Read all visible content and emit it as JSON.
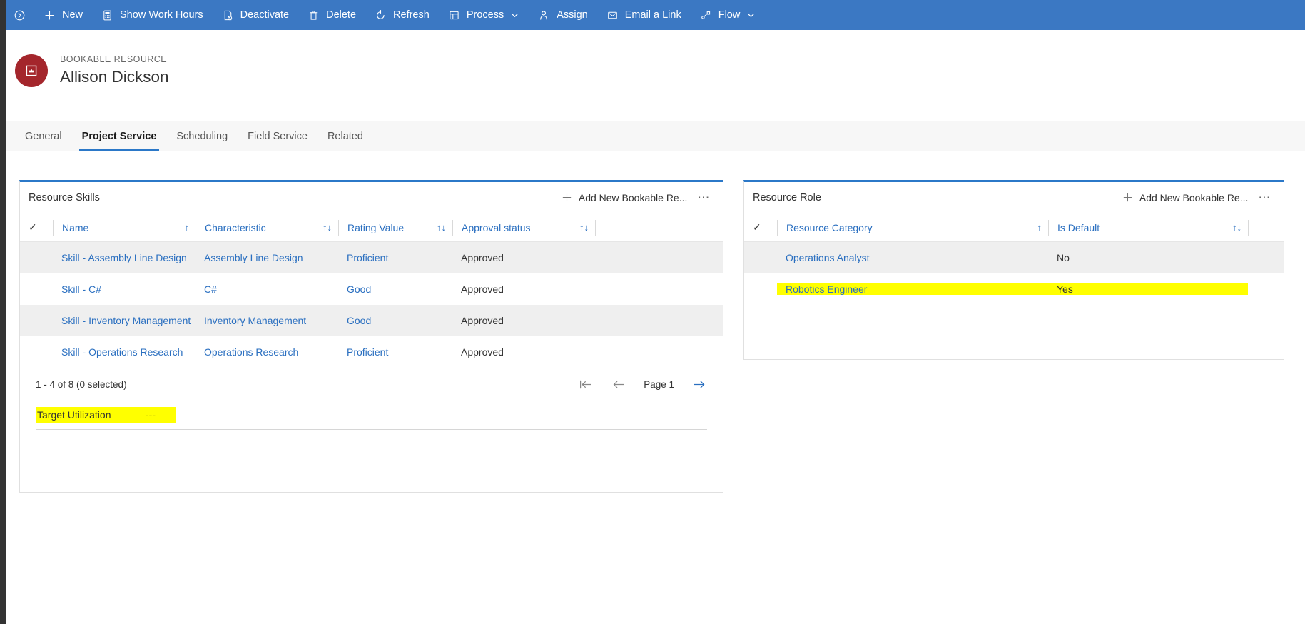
{
  "command_bar": {
    "background": "#3b78c3",
    "first_icon": "chevron-circle-right-icon",
    "items": [
      {
        "icon": "plus-icon",
        "label": "New",
        "caret": false
      },
      {
        "icon": "calculator-icon",
        "label": "Show Work Hours",
        "caret": false
      },
      {
        "icon": "deactivate-icon",
        "label": "Deactivate",
        "caret": false
      },
      {
        "icon": "trash-icon",
        "label": "Delete",
        "caret": false
      },
      {
        "icon": "refresh-icon",
        "label": "Refresh",
        "caret": false
      },
      {
        "icon": "process-icon",
        "label": "Process",
        "caret": true
      },
      {
        "icon": "person-icon",
        "label": "Assign",
        "caret": false
      },
      {
        "icon": "envelope-icon",
        "label": "Email a Link",
        "caret": false
      },
      {
        "icon": "flow-icon",
        "label": "Flow",
        "caret": true
      }
    ]
  },
  "record_header": {
    "entity_label": "BOOKABLE RESOURCE",
    "record_name": "Allison Dickson",
    "avatar_icon": "bookable-resource-icon",
    "avatar_color": "#a4262c"
  },
  "tabs": {
    "accent_color": "#2b78c8",
    "items": [
      {
        "label": "General",
        "active": false
      },
      {
        "label": "Project Service",
        "active": true
      },
      {
        "label": "Scheduling",
        "active": false
      },
      {
        "label": "Field Service",
        "active": false
      },
      {
        "label": "Related",
        "active": false
      }
    ]
  },
  "skills_panel": {
    "title": "Resource Skills",
    "add_label": "Add New Bookable Re...",
    "add_icon": "plus-icon",
    "overflow_icon": "ellipsis-icon",
    "select_all_icon": "checkmark-icon",
    "columns": [
      {
        "label": "Name",
        "sort": "↑",
        "width_class": "c-name"
      },
      {
        "label": "Characteristic",
        "sort": "↑↓",
        "width_class": "c-char"
      },
      {
        "label": "Rating Value",
        "sort": "↑↓",
        "width_class": "c-rate"
      },
      {
        "label": "Approval status",
        "sort": "↑↓",
        "width_class": "c-appr"
      }
    ],
    "rows": [
      {
        "name": "Skill - Assembly Line Design",
        "characteristic": "Assembly Line Design",
        "rating": "Proficient",
        "approval": "Approved"
      },
      {
        "name": "Skill - C#",
        "characteristic": "C#",
        "rating": "Good",
        "approval": "Approved"
      },
      {
        "name": "Skill - Inventory Management",
        "characteristic": "Inventory Management",
        "rating": "Good",
        "approval": "Approved"
      },
      {
        "name": "Skill - Operations Research",
        "characteristic": "Operations Research",
        "rating": "Proficient",
        "approval": "Approved"
      }
    ],
    "footer": {
      "count_text": "1 - 4 of 8 (0 selected)",
      "page_label": "Page 1",
      "first_page_icon": "first-page-arrow-icon",
      "prev_page_icon": "previous-page-arrow-icon",
      "next_page_icon": "next-page-arrow-icon"
    },
    "target_utilization": {
      "label": "Target Utilization",
      "value": "---",
      "highlight_color": "#ffff00"
    }
  },
  "role_panel": {
    "title": "Resource Role",
    "add_label": "Add New Bookable Re...",
    "add_icon": "plus-icon",
    "overflow_icon": "ellipsis-icon",
    "select_all_icon": "checkmark-icon",
    "columns": [
      {
        "label": "Resource Category",
        "sort": "↑",
        "width_class": "c-cat"
      },
      {
        "label": "Is Default",
        "sort": "↑↓",
        "width_class": "c-def"
      }
    ],
    "rows": [
      {
        "category": "Operations Analyst",
        "is_default": "No",
        "highlighted": false
      },
      {
        "category": "Robotics Engineer",
        "is_default": "Yes",
        "highlighted": true
      }
    ]
  }
}
